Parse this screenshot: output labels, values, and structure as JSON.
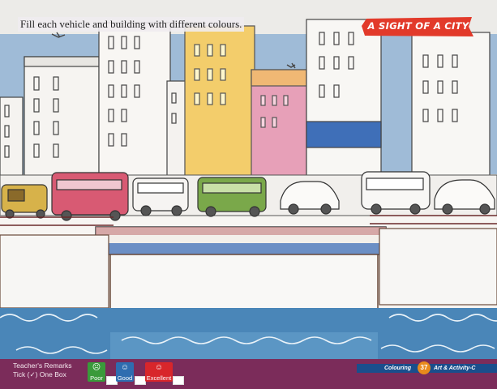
{
  "instruction": "Fill each vehicle and building with different colours.",
  "title_banner": "A SIGHT OF A CITY",
  "remarks": {
    "line1": "Teacher's Remarks",
    "line2": "Tick (✓) One Box",
    "options": [
      {
        "label": "Poor",
        "color": "#3a9a3a",
        "face": "☹"
      },
      {
        "label": "Good",
        "color": "#2f6db0",
        "face": "☺"
      },
      {
        "label": "Excellent",
        "color": "#d8262b",
        "face": "☺"
      }
    ]
  },
  "footer_bar": {
    "section": "Colouring",
    "page_number": "37",
    "book": "Art & Activity-C"
  },
  "colors": {
    "sky": "#5b8fc9",
    "water": "#4a86b8",
    "footer": "#7b2c5a",
    "banner": "#e23a2a"
  }
}
